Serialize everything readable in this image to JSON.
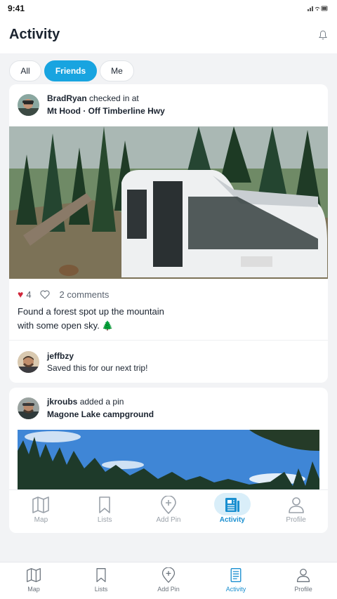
{
  "status": {
    "time": "9:41"
  },
  "header": {
    "title": "Activity"
  },
  "filters": [
    {
      "label": "All",
      "active": false
    },
    {
      "label": "Friends",
      "active": true
    },
    {
      "label": "Me",
      "active": false
    }
  ],
  "posts": [
    {
      "user": "BradRyan",
      "action": "checked in at",
      "place": "Mt Hood · Off Timberline Hwy",
      "likes": "4",
      "comments": "2 comments",
      "text_line1": "Found a forest spot up the mountain",
      "text_line2": "with some open sky. 🌲",
      "comment": {
        "user": "jeffbzy",
        "text": "Saved this for our next trip!"
      }
    },
    {
      "user": "jkroubs",
      "action": "added a pin",
      "place": "Magone Lake campground"
    }
  ],
  "tabs_inner": [
    {
      "label": "Map",
      "icon": "map-icon"
    },
    {
      "label": "Lists",
      "icon": "bookmark-icon"
    },
    {
      "label": "Add Pin",
      "icon": "add-pin-icon"
    },
    {
      "label": "Activity",
      "icon": "activity-icon",
      "active": true
    },
    {
      "label": "Profile",
      "icon": "profile-icon"
    }
  ],
  "tabs": [
    {
      "label": "Map",
      "icon": "map-icon"
    },
    {
      "label": "Lists",
      "icon": "bookmark-icon"
    },
    {
      "label": "Add Pin",
      "icon": "add-pin-icon"
    },
    {
      "label": "Activity",
      "icon": "activity-icon",
      "active": true
    },
    {
      "label": "Profile",
      "icon": "profile-icon"
    }
  ],
  "colors": {
    "accent": "#18a4e0",
    "like": "#d0263a"
  }
}
